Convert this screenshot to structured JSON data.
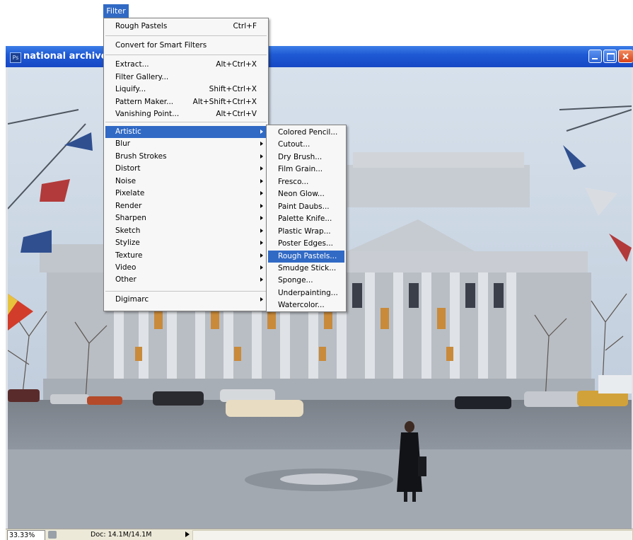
{
  "menubar": {
    "filter_label": "Filter"
  },
  "document": {
    "title": "national archives",
    "app_icon": "Ps",
    "zoom": "33.33%",
    "doc_size": "Doc: 14.1M/14.1M"
  },
  "filter_menu": {
    "last_filter": {
      "label": "Rough Pastels",
      "shortcut": "Ctrl+F"
    },
    "convert": {
      "label": "Convert for Smart Filters"
    },
    "tools": [
      {
        "label": "Extract...",
        "shortcut": "Alt+Ctrl+X"
      },
      {
        "label": "Filter Gallery...",
        "shortcut": ""
      },
      {
        "label": "Liquify...",
        "shortcut": "Shift+Ctrl+X"
      },
      {
        "label": "Pattern Maker...",
        "shortcut": "Alt+Shift+Ctrl+X"
      },
      {
        "label": "Vanishing Point...",
        "shortcut": "Alt+Ctrl+V"
      }
    ],
    "categories": [
      "Artistic",
      "Blur",
      "Brush Strokes",
      "Distort",
      "Noise",
      "Pixelate",
      "Render",
      "Sharpen",
      "Sketch",
      "Stylize",
      "Texture",
      "Video",
      "Other"
    ],
    "highlighted_category": "Artistic",
    "digimarc": "Digimarc"
  },
  "artistic_menu": {
    "items": [
      "Colored Pencil...",
      "Cutout...",
      "Dry Brush...",
      "Film Grain...",
      "Fresco...",
      "Neon Glow...",
      "Paint Daubs...",
      "Palette Knife...",
      "Plastic Wrap...",
      "Poster Edges...",
      "Rough Pastels...",
      "Smudge Stick...",
      "Sponge...",
      "Underpainting...",
      "Watercolor..."
    ],
    "highlighted_item": "Rough Pastels..."
  },
  "colors": {
    "highlight": "#316ac5",
    "title_bar": "#1f5ad4",
    "close_button": "#d9431a"
  },
  "icons": {
    "app": "photoshop-icon",
    "minimize": "minimize-icon",
    "maximize": "maximize-icon",
    "close": "close-icon",
    "submenu": "chevron-right-icon"
  }
}
